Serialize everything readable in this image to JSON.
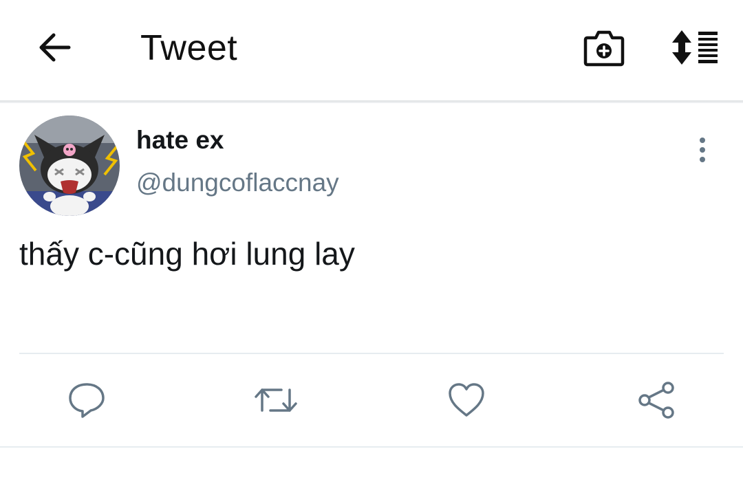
{
  "app_bar": {
    "title": "Tweet",
    "icons": {
      "back": "back-arrow-icon",
      "camera": "camera-plus-icon",
      "sort": "sort-lines-icon"
    }
  },
  "tweet": {
    "display_name": "hate ex",
    "handle": "@dungcoflaccnay",
    "text": "thấy c-cũng hơi lung lay",
    "avatar": "avatar-kuromi-cartoon"
  },
  "actions": [
    "reply-icon",
    "retweet-icon",
    "like-icon",
    "share-icon"
  ],
  "colors": {
    "primary_text": "#14171a",
    "secondary_text": "#657786",
    "divider": "#e6ecf0"
  }
}
